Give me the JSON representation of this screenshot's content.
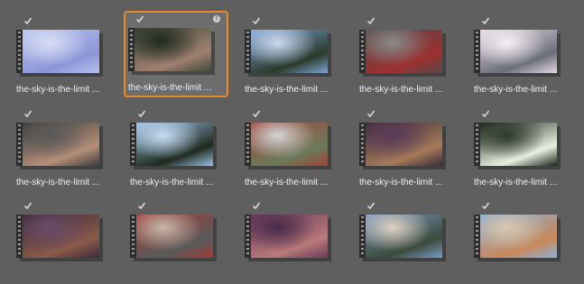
{
  "media_bin": {
    "rows": [
      {
        "clips": [
          {
            "label": "the-sky-is-the-limit ...",
            "checked": true,
            "selected": false,
            "thumb_colors": [
              "#b7c3ec",
              "#8b96d8",
              "#d8ddf4"
            ],
            "thumb_icon": "sky-clip-thumbnail"
          },
          {
            "label": "the-sky-is-the-limit ...",
            "checked": true,
            "selected": true,
            "info": "i",
            "thumb_colors": [
              "#3f4a3a",
              "#a08070",
              "#1f2a1f"
            ],
            "thumb_icon": "trees-clip-thumbnail"
          },
          {
            "label": "the-sky-is-the-limit ...",
            "checked": true,
            "selected": false,
            "thumb_colors": [
              "#7fa3d6",
              "#2a3a2a",
              "#c9d8ee"
            ],
            "thumb_icon": "forest-sky-clip-thumbnail"
          },
          {
            "label": "the-sky-is-the-limit ...",
            "checked": true,
            "selected": false,
            "thumb_colors": [
              "#5a4a4a",
              "#9c2f2f",
              "#8a8a8a"
            ],
            "thumb_icon": "car-road-clip-thumbnail"
          },
          {
            "label": "the-sky-is-the-limit ...",
            "checked": true,
            "selected": false,
            "thumb_colors": [
              "#e7d9e6",
              "#6b6f7a",
              "#f4eef3"
            ],
            "thumb_icon": "mountain-clip-thumbnail"
          }
        ]
      },
      {
        "clips": [
          {
            "label": "the-sky-is-the-limit ...",
            "checked": true,
            "selected": false,
            "thumb_colors": [
              "#3a3a3a",
              "#b58f7a",
              "#5a5a5a"
            ],
            "thumb_icon": "hand-bike-clip-thumbnail"
          },
          {
            "label": "the-sky-is-the-limit ...",
            "checked": true,
            "selected": false,
            "thumb_colors": [
              "#9cc0e6",
              "#1e2a1e",
              "#c5dcf0"
            ],
            "thumb_icon": "tree-tops-clip-thumbnail"
          },
          {
            "label": "the-sky-is-the-limit ...",
            "checked": true,
            "selected": false,
            "thumb_colors": [
              "#a0433a",
              "#6b7a5a",
              "#d4d4d4"
            ],
            "thumb_icon": "red-van-clip-thumbnail"
          },
          {
            "label": "the-sky-is-the-limit ...",
            "checked": true,
            "selected": false,
            "thumb_colors": [
              "#3a2a3a",
              "#a67a5a",
              "#5a3a5a"
            ],
            "thumb_icon": "car-interior-clip-thumbnail"
          },
          {
            "label": "the-sky-is-the-limit ...",
            "checked": true,
            "selected": false,
            "thumb_colors": [
              "#1a221a",
              "#e8f0e0",
              "#2f3a2a"
            ],
            "thumb_icon": "sun-through-leaves-clip-thumbnail"
          }
        ]
      },
      {
        "clips": [
          {
            "label": "",
            "checked": true,
            "selected": false,
            "thumb_colors": [
              "#3a2a3a",
              "#8a5a4a",
              "#6a4a6a"
            ],
            "thumb_icon": "bike-parts-clip-thumbnail"
          },
          {
            "label": "",
            "checked": true,
            "selected": false,
            "thumb_colors": [
              "#a03a3a",
              "#5a5a5a",
              "#c8b8a8"
            ],
            "thumb_icon": "red-bike-clip-thumbnail"
          },
          {
            "label": "",
            "checked": true,
            "selected": false,
            "thumb_colors": [
              "#6a3a5a",
              "#b87a7a",
              "#4a2a4a"
            ],
            "thumb_icon": "closeup-clip-thumbnail"
          },
          {
            "label": "",
            "checked": true,
            "selected": false,
            "thumb_colors": [
              "#7a9ac6",
              "#3a4a3a",
              "#e0d0c0"
            ],
            "thumb_icon": "person-sky-clip-thumbnail"
          },
          {
            "label": "",
            "checked": true,
            "selected": false,
            "thumb_colors": [
              "#8ab0d8",
              "#c8885a",
              "#d8c8b0"
            ],
            "thumb_icon": "woman-portrait-clip-thumbnail"
          }
        ]
      }
    ]
  }
}
